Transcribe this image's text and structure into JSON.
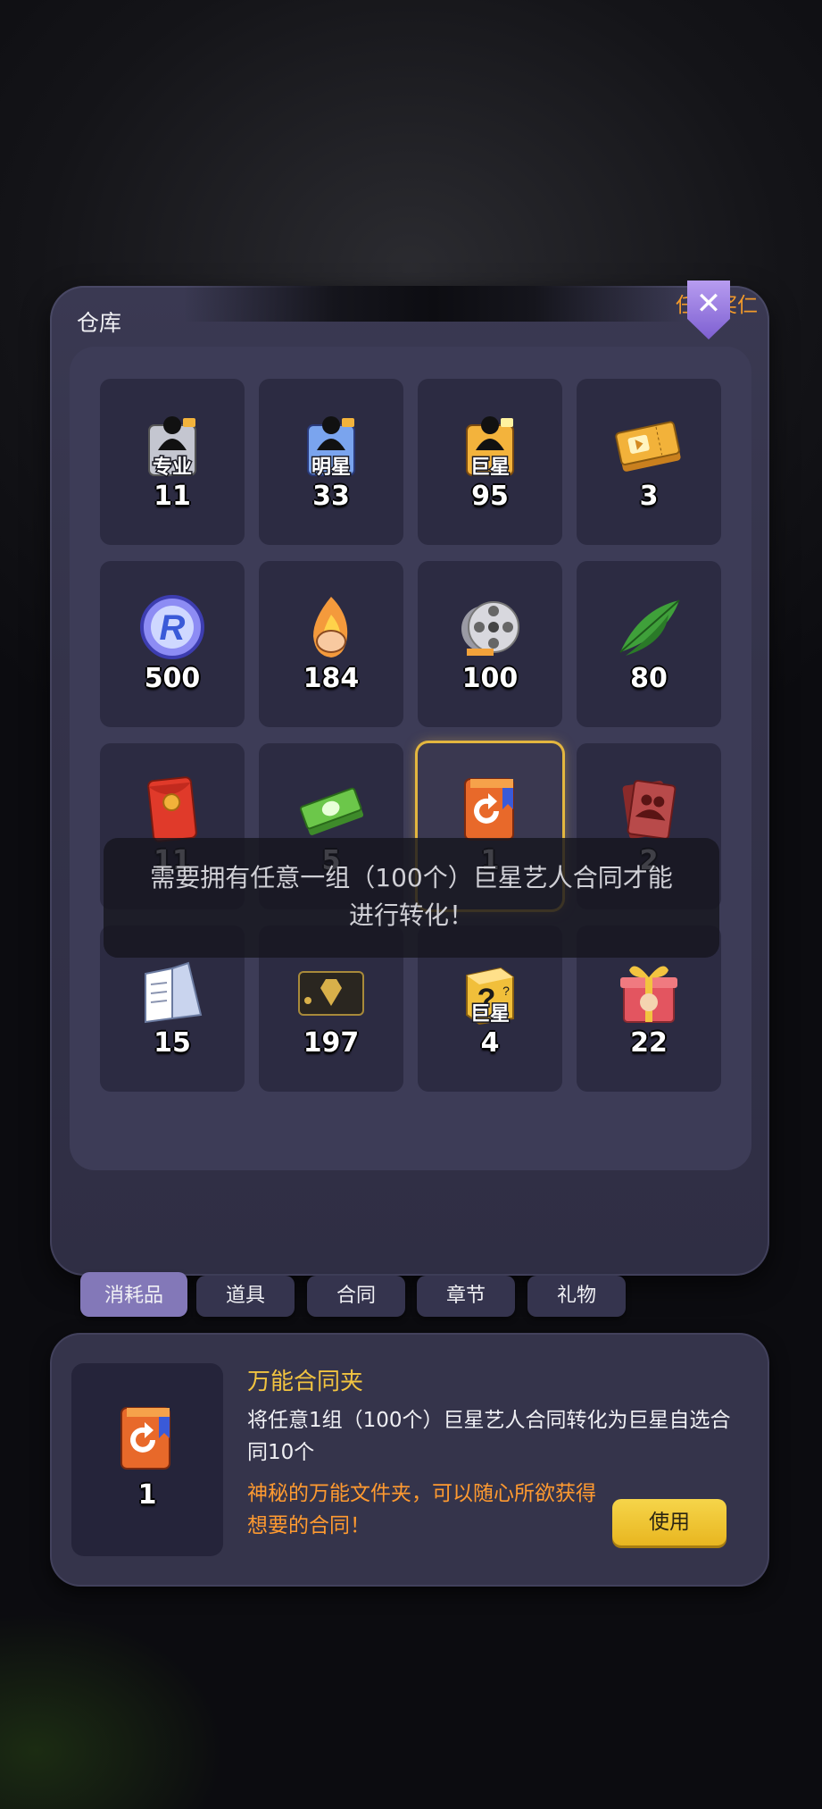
{
  "warehouse": {
    "title": "仓库",
    "watermark": "任务奖仁",
    "close_icon": "close-x-icon"
  },
  "items": [
    {
      "count": "11",
      "icon": "contract-pro-icon",
      "icon_label": "专业",
      "color": "#c4c6d0"
    },
    {
      "count": "33",
      "icon": "contract-star-icon",
      "icon_label": "明星",
      "color": "#7aa4ee"
    },
    {
      "count": "95",
      "icon": "contract-superstar-icon",
      "icon_label": "巨星",
      "color": "#f3b33c"
    },
    {
      "count": "3",
      "icon": "ticket-icon",
      "icon_label": "",
      "color": "#f2b23a"
    },
    {
      "count": "500",
      "icon": "r-coin-icon",
      "icon_label": "",
      "color": "#8d8cf4"
    },
    {
      "count": "184",
      "icon": "hand-fire-icon",
      "icon_label": "",
      "color": "#f49a3c"
    },
    {
      "count": "100",
      "icon": "film-reel-icon",
      "icon_label": "",
      "color": "#d8d8de"
    },
    {
      "count": "80",
      "icon": "leaf-icon",
      "icon_label": "",
      "color": "#3fa03a"
    },
    {
      "count": "11",
      "icon": "red-envelope-icon",
      "icon_label": "",
      "color": "#e03a2a"
    },
    {
      "count": "5",
      "icon": "cash-stack-icon",
      "icon_label": "",
      "color": "#6cc74a"
    },
    {
      "count": "1",
      "icon": "contract-folder-icon",
      "icon_label": "",
      "color": "#e8692a",
      "selected": true
    },
    {
      "count": "2",
      "icon": "photo-cards-icon",
      "icon_label": "",
      "color": "#b84a4a"
    },
    {
      "count": "15",
      "icon": "script-book-icon",
      "icon_label": "",
      "color": "#c9d4ee"
    },
    {
      "count": "197",
      "icon": "black-card-icon",
      "icon_label": "",
      "color": "#2a2620"
    },
    {
      "count": "4",
      "icon": "mystery-box-icon",
      "icon_label": "巨星",
      "color": "#f1bf3a"
    },
    {
      "count": "22",
      "icon": "gift-box-icon",
      "icon_label": "",
      "color": "#e35560"
    }
  ],
  "toast": {
    "message": "需要拥有任意一组（100个）巨星艺人合同才能进行转化！"
  },
  "tabs": [
    {
      "label": "消耗品",
      "active": true
    },
    {
      "label": "道具",
      "active": false
    },
    {
      "label": "合同",
      "active": false
    },
    {
      "label": "章节",
      "active": false
    },
    {
      "label": "礼物",
      "active": false
    }
  ],
  "detail": {
    "count": "1",
    "icon": "contract-folder-icon",
    "name": "万能合同夹",
    "description": "将任意1组（100个）巨星艺人合同转化为巨星自选合同10个",
    "flavor": "神秘的万能文件夹，可以随心所欲获得想要的合同！",
    "use_label": "使用"
  },
  "colors": {
    "accent_gold": "#f2c440",
    "accent_orange": "#ff9a30",
    "tab_active": "#8378b8",
    "panel": "#34334a"
  }
}
